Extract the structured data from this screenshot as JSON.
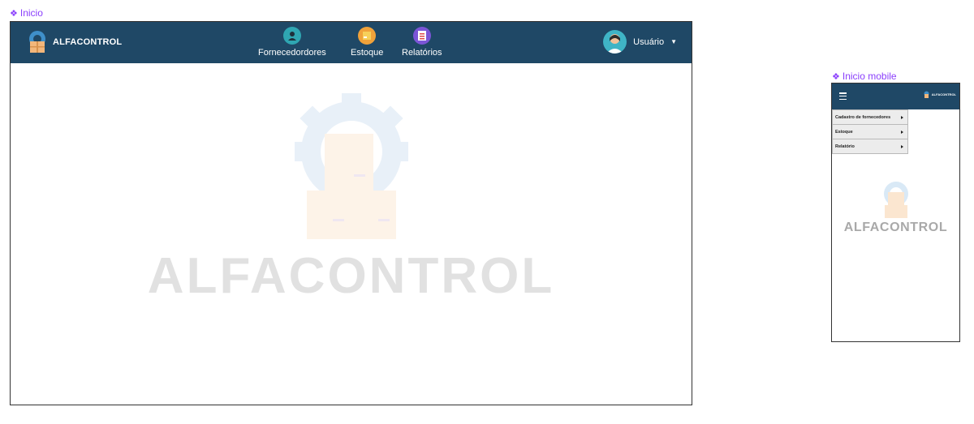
{
  "frames": {
    "desktop_label": "Inicio",
    "mobile_label": "Inicio mobile"
  },
  "navbar": {
    "brand": "ALFACONTROL",
    "items": [
      {
        "label": "Fornecedordores",
        "icon": "supplier-person-icon",
        "color": "#2fa6b2"
      },
      {
        "label": "Estoque",
        "icon": "box-icon",
        "color": "#f0a23a"
      },
      {
        "label": "Relatórios",
        "icon": "clipboard-report-icon",
        "color": "#7b55d6"
      }
    ],
    "user": {
      "label": "Usuário",
      "icon": "user-avatar-icon"
    }
  },
  "watermark": {
    "text": "ALFACONTROL"
  },
  "mobile": {
    "brand": "ALFACONTROL",
    "menu": [
      {
        "label": "Cadastro de fornecedores"
      },
      {
        "label": "Estoque"
      },
      {
        "label": "Relatório"
      }
    ],
    "watermark": "ALFACONTROL"
  },
  "colors": {
    "navbar": "#1f4866",
    "frame_label": "#8a3ffc",
    "watermark_text": "#e1e1e1"
  }
}
